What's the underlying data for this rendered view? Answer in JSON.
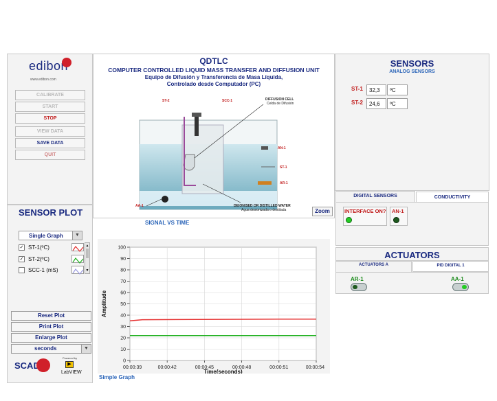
{
  "brand": {
    "logo": "edibon",
    "url": "www.edibon.com",
    "scada_logo": "SCADA",
    "powered_by": "Powered by",
    "labview": "LabVIEW"
  },
  "header": {
    "code": "QDTLC",
    "title": "COMPUTER CONTROLLED LIQUID MASS TRANSFER AND DIFFUSION UNIT",
    "subtitle_line1": "Equipo de Difusión y Transferencia de Masa Líquida,",
    "subtitle_line2": "Controlado desde Computador (PC)"
  },
  "buttons": {
    "calibrate": "CALIBRATE",
    "start": "START",
    "stop": "STOP",
    "view_data": "VIEW DATA",
    "save_data": "SAVE DATA",
    "quit": "QUIT",
    "zoom": "Zoom"
  },
  "schematic": {
    "st2": "ST-2",
    "scc1": "SCC-1",
    "diff_cell": "DIFFUSION CELL",
    "diff_cell_es": "Celda de Difusión",
    "an1": "AN-1",
    "st1": "ST-1",
    "ar1": "AR-1",
    "aa1": "AA-1",
    "water": "DEIONISED OR DISTILLED WATER",
    "water_es": "Agua desionizada o destilada"
  },
  "sensors": {
    "title": "SENSORS",
    "analog_title": "ANALOG SENSORS",
    "st1": {
      "tag": "ST-1",
      "value": "32,3",
      "unit": "ºC"
    },
    "st2": {
      "tag": "ST-2",
      "value": "24,6",
      "unit": "ºC"
    },
    "tab_digital": "DIGITAL SENSORS",
    "tab_conductivity": "CONDUCTIVITY",
    "interface_label": "INTERFACE ON?",
    "an1_label": "AN-1",
    "colors": {
      "led_on": "#22cc22",
      "led_off": "#1e5a1e"
    }
  },
  "actuators": {
    "title": "ACTUATORS",
    "tab_a": "ACTUATORS A",
    "tab_pid": "PID DIGITAL 1",
    "ar1": "AR-1",
    "aa1": "AA-1"
  },
  "plot": {
    "title": "SENSOR PLOT",
    "signal_title": "SIGNAL VS TIME",
    "mode": "Single Graph",
    "legend": [
      {
        "label": "ST-1(ºC)",
        "checked": true,
        "check": "✓",
        "color": "#e53030"
      },
      {
        "label": "ST-2(ºC)",
        "checked": true,
        "check": "✓",
        "color": "#20b020"
      },
      {
        "label": "SCC-1 (mS)",
        "checked": false,
        "check": "",
        "color": "#9a9ae0"
      }
    ],
    "reset": "Reset Plot",
    "print": "Print Plot",
    "enlarge": "Enlarge Plot",
    "units": "seconds",
    "footer_mode": "Simple Graph"
  },
  "chart_data": {
    "type": "line",
    "xlabel": "Time(seconds)",
    "ylabel": "Amplitude",
    "ylim": [
      0,
      100
    ],
    "yticks": [
      "0",
      "10",
      "20",
      "30",
      "40",
      "50",
      "60",
      "70",
      "80",
      "90",
      "100"
    ],
    "xticks": [
      "00:00:39",
      "00:00:42",
      "00:00:45",
      "00:00:48",
      "00:00:51",
      "00:00:54"
    ],
    "grid": true,
    "series": [
      {
        "name": "ST-1(ºC)",
        "color": "#e53030",
        "x": [
          "00:00:39",
          "00:00:40",
          "00:00:51",
          "00:00:54"
        ],
        "values": [
          35.0,
          36.0,
          36.5,
          36.5
        ]
      },
      {
        "name": "ST-2(ºC)",
        "color": "#20b020",
        "x": [
          "00:00:39",
          "00:00:54"
        ],
        "values": [
          22.0,
          22.0
        ]
      }
    ]
  }
}
